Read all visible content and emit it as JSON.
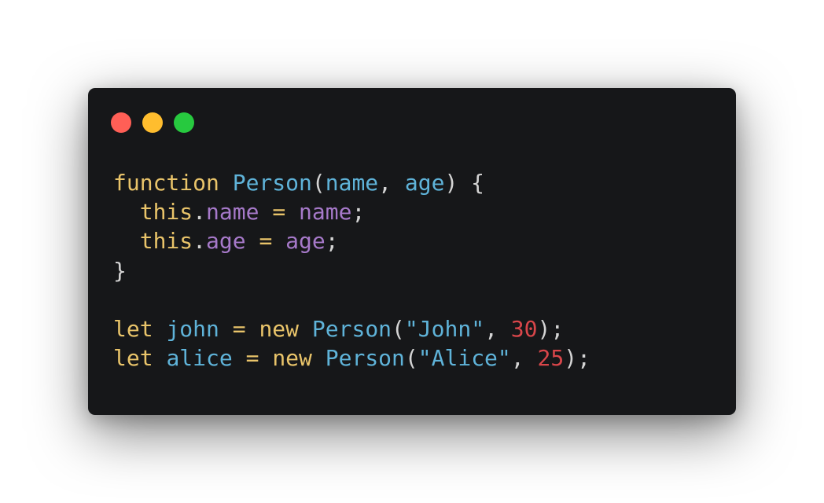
{
  "window_controls": {
    "close_color": "#ff5f56",
    "minimize_color": "#ffbd2e",
    "zoom_color": "#27c93f"
  },
  "code": {
    "language": "javascript",
    "lines": [
      [
        {
          "text": "function",
          "kind": "keyword"
        },
        {
          "text": " ",
          "kind": "space"
        },
        {
          "text": "Person",
          "kind": "function-name"
        },
        {
          "text": "(",
          "kind": "punctuation"
        },
        {
          "text": "name",
          "kind": "parameter"
        },
        {
          "text": ", ",
          "kind": "punctuation"
        },
        {
          "text": "age",
          "kind": "parameter"
        },
        {
          "text": ") {",
          "kind": "punctuation"
        }
      ],
      [
        {
          "text": "  ",
          "kind": "space"
        },
        {
          "text": "this",
          "kind": "keyword"
        },
        {
          "text": ".",
          "kind": "punctuation"
        },
        {
          "text": "name",
          "kind": "property"
        },
        {
          "text": " ",
          "kind": "space"
        },
        {
          "text": "=",
          "kind": "operator"
        },
        {
          "text": " ",
          "kind": "space"
        },
        {
          "text": "name",
          "kind": "property"
        },
        {
          "text": ";",
          "kind": "punctuation"
        }
      ],
      [
        {
          "text": "  ",
          "kind": "space"
        },
        {
          "text": "this",
          "kind": "keyword"
        },
        {
          "text": ".",
          "kind": "punctuation"
        },
        {
          "text": "age",
          "kind": "property"
        },
        {
          "text": " ",
          "kind": "space"
        },
        {
          "text": "=",
          "kind": "operator"
        },
        {
          "text": " ",
          "kind": "space"
        },
        {
          "text": "age",
          "kind": "property"
        },
        {
          "text": ";",
          "kind": "punctuation"
        }
      ],
      [
        {
          "text": "}",
          "kind": "punctuation"
        }
      ],
      [],
      [
        {
          "text": "let",
          "kind": "keyword"
        },
        {
          "text": " ",
          "kind": "space"
        },
        {
          "text": "john",
          "kind": "parameter"
        },
        {
          "text": " ",
          "kind": "space"
        },
        {
          "text": "=",
          "kind": "operator"
        },
        {
          "text": " ",
          "kind": "space"
        },
        {
          "text": "new",
          "kind": "keyword"
        },
        {
          "text": " ",
          "kind": "space"
        },
        {
          "text": "Person",
          "kind": "function-name"
        },
        {
          "text": "(",
          "kind": "punctuation"
        },
        {
          "text": "\"John\"",
          "kind": "string"
        },
        {
          "text": ", ",
          "kind": "punctuation"
        },
        {
          "text": "30",
          "kind": "number"
        },
        {
          "text": ");",
          "kind": "punctuation"
        }
      ],
      [
        {
          "text": "let",
          "kind": "keyword"
        },
        {
          "text": " ",
          "kind": "space"
        },
        {
          "text": "alice",
          "kind": "parameter"
        },
        {
          "text": " ",
          "kind": "space"
        },
        {
          "text": "=",
          "kind": "operator"
        },
        {
          "text": " ",
          "kind": "space"
        },
        {
          "text": "new",
          "kind": "keyword"
        },
        {
          "text": " ",
          "kind": "space"
        },
        {
          "text": "Person",
          "kind": "function-name"
        },
        {
          "text": "(",
          "kind": "punctuation"
        },
        {
          "text": "\"Alice\"",
          "kind": "string"
        },
        {
          "text": ", ",
          "kind": "punctuation"
        },
        {
          "text": "25",
          "kind": "number"
        },
        {
          "text": ");",
          "kind": "punctuation"
        }
      ]
    ]
  }
}
